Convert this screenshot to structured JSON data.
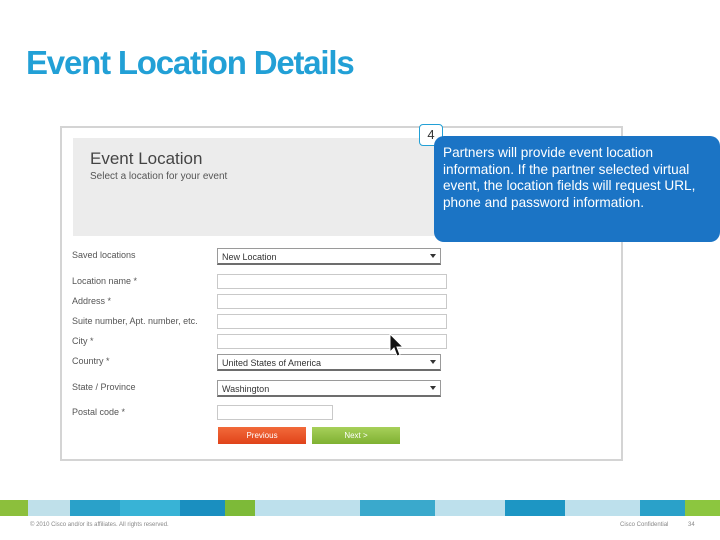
{
  "slide": {
    "title": "Event Location Details",
    "step_number": "4",
    "callout_text": "Partners will provide event location information.  If the partner selected virtual event, the location fields will request URL, phone and password information."
  },
  "form": {
    "header_title": "Event Location",
    "header_subtitle": "Select a location for your event",
    "fields": [
      {
        "label": "Saved locations",
        "type": "select",
        "value": "New Location"
      },
      {
        "label": "Location name *",
        "type": "text",
        "value": ""
      },
      {
        "label": "Address *",
        "type": "text",
        "value": ""
      },
      {
        "label": "Suite number, Apt. number, etc.",
        "type": "text",
        "value": ""
      },
      {
        "label": "City *",
        "type": "text",
        "value": ""
      },
      {
        "label": "Country *",
        "type": "select",
        "value": "United States of America"
      },
      {
        "label": "State / Province",
        "type": "select",
        "value": "Washington"
      },
      {
        "label": "Postal code *",
        "type": "text",
        "value": ""
      }
    ],
    "buttons": {
      "previous": "Previous",
      "next": "Next >"
    }
  },
  "footer": {
    "copyright": "© 2010 Cisco and/or its affiliates. All rights reserved.",
    "confidential": "Cisco Confidential",
    "page_number": "34"
  },
  "colors": {
    "title": "#22a0d6",
    "callout": "#1b74c5",
    "previous_button": "#e0431a",
    "next_button": "#7fb132",
    "footer_bar": [
      "#8cbf3c",
      "#bfe0ea",
      "#2aa1c9",
      "#38b3d6",
      "#1a8fc0",
      "#7dba38",
      "#bde0ec",
      "#3aa9cc",
      "#1d96c4",
      "#8cc63f"
    ]
  },
  "icons": {
    "cursor": "mouse-pointer-icon",
    "select_caret": "caret-down-icon"
  }
}
